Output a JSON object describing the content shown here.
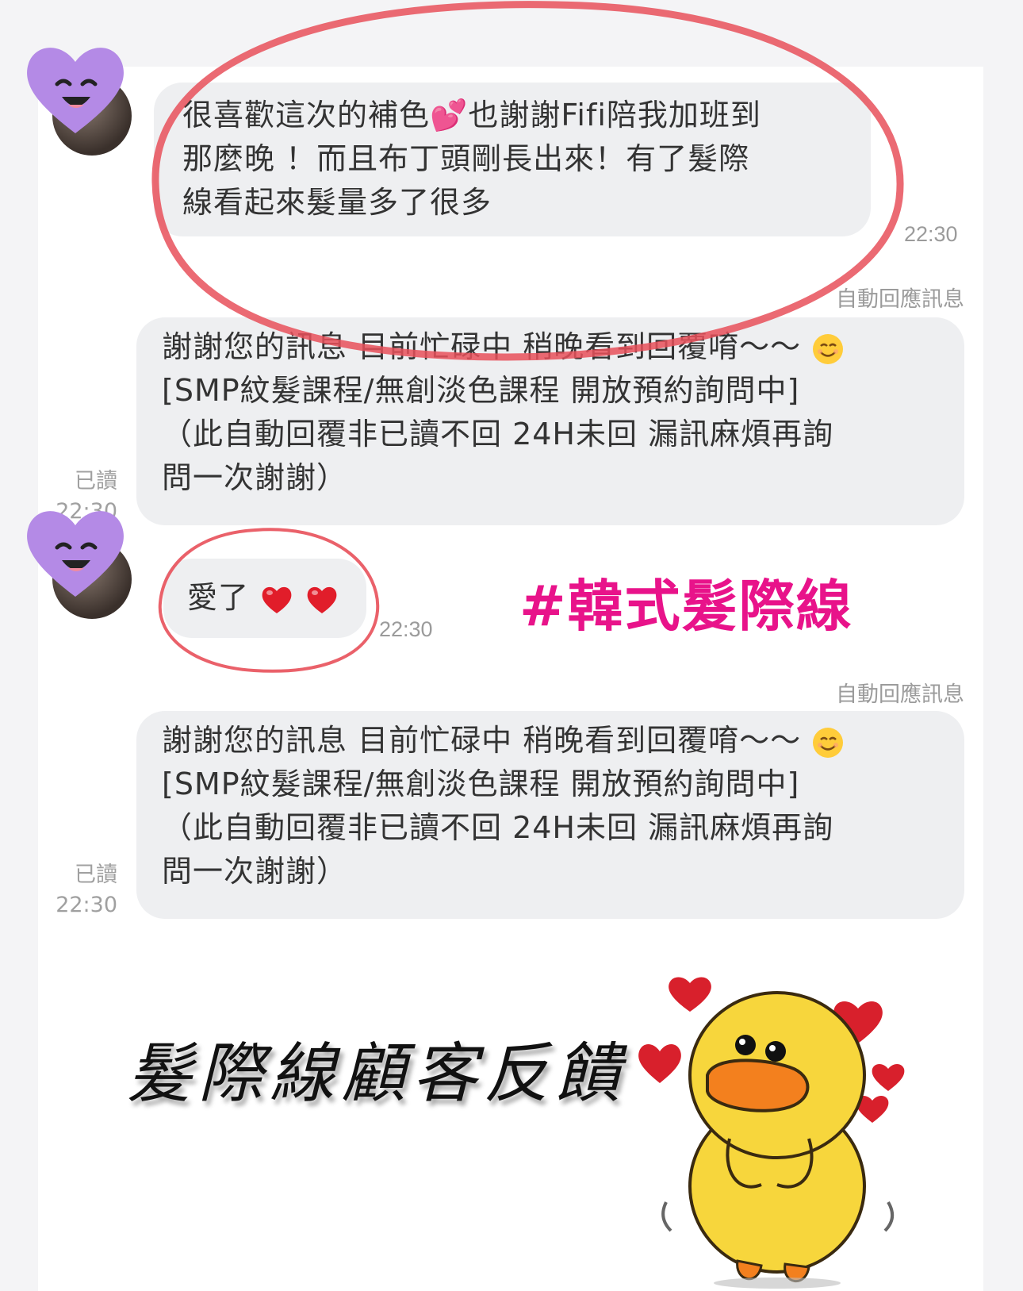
{
  "messages": {
    "m1": {
      "lines": [
        "很喜歡這次的補色💕也謝謝Fifi陪我加班到",
        "那麼晚 ！而且布丁頭剛長出來！有了髮際",
        "線看起來髮量多了很多"
      ],
      "time": "22:30"
    },
    "auto1": {
      "label": "自動回應訊息",
      "lines": [
        "謝謝您的訊息 目前忙碌中 稍晚看到回覆唷～～",
        "[SMP紋髮課程/無創淡色課程 開放預約詢問中]",
        "（此自動回覆非已讀不回 24H未回 漏訊麻煩再詢",
        "問一次謝謝）"
      ],
      "read": "已讀",
      "time": "22:30"
    },
    "m2": {
      "text": "愛了",
      "time": "22:30"
    },
    "auto2": {
      "label": "自動回應訊息",
      "lines": [
        "謝謝您的訊息 目前忙碌中 稍晚看到回覆唷～～",
        "[SMP紋髮課程/無創淡色課程 開放預約詢問中]",
        "（此自動回覆非已讀不回 24H未回 漏訊麻煩再詢",
        "問一次謝謝）"
      ],
      "read": "已讀",
      "time": "22:30"
    }
  },
  "hashtag": "#韓式髮際線",
  "footer_title": "髮際線顧客反饋",
  "colors": {
    "bubble": "#eeeff1",
    "hashtag": "#e8138a",
    "annotation_circle": "#e8505a",
    "avatar_heart": "#b48ae6",
    "sticker_duck": "#f7d63c"
  },
  "icons": [
    "heart-face-sticker-icon",
    "smile-emoji-icon",
    "red-heart-icon",
    "duck-sticker-icon"
  ]
}
